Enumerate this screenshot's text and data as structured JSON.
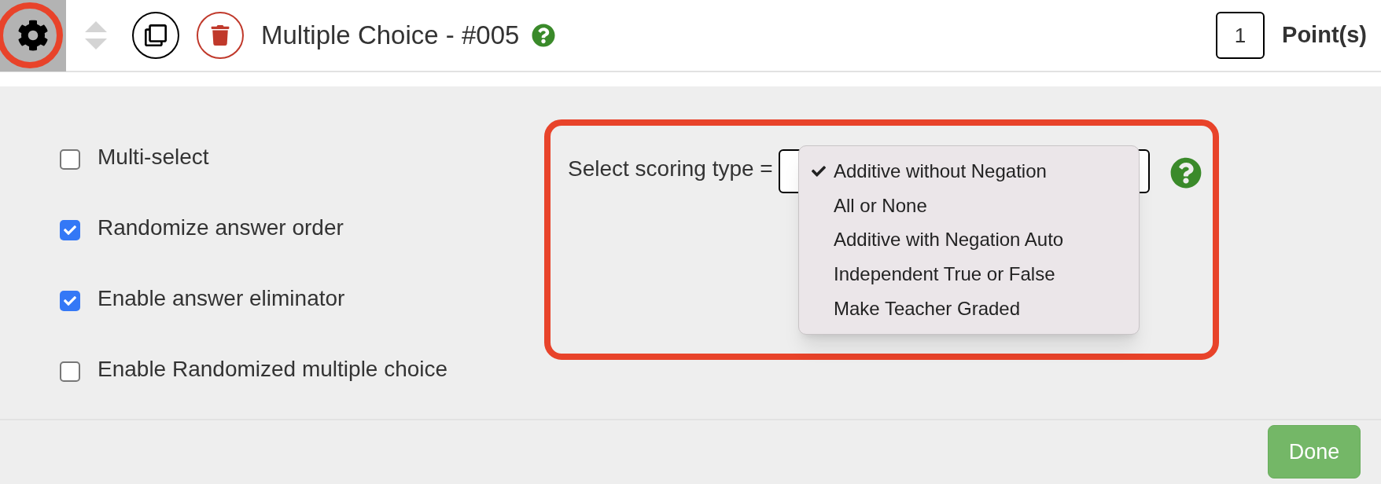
{
  "header": {
    "title": "Multiple Choice - #005",
    "points": "1",
    "points_label": "Point(s)"
  },
  "options": [
    {
      "label": "Multi-select",
      "checked": false
    },
    {
      "label": "Randomize answer order",
      "checked": true
    },
    {
      "label": "Enable answer eliminator",
      "checked": true
    },
    {
      "label": "Enable Randomized multiple choice",
      "checked": false
    }
  ],
  "scoring": {
    "label": "Select scoring type =",
    "menu": [
      {
        "label": "Additive without Negation",
        "selected": true
      },
      {
        "label": "All or None",
        "selected": false
      },
      {
        "label": "Additive with Negation Auto",
        "selected": false
      },
      {
        "label": "Independent True or False",
        "selected": false
      },
      {
        "label": "Make Teacher Graded",
        "selected": false
      }
    ]
  },
  "footer": {
    "done": "Done"
  }
}
